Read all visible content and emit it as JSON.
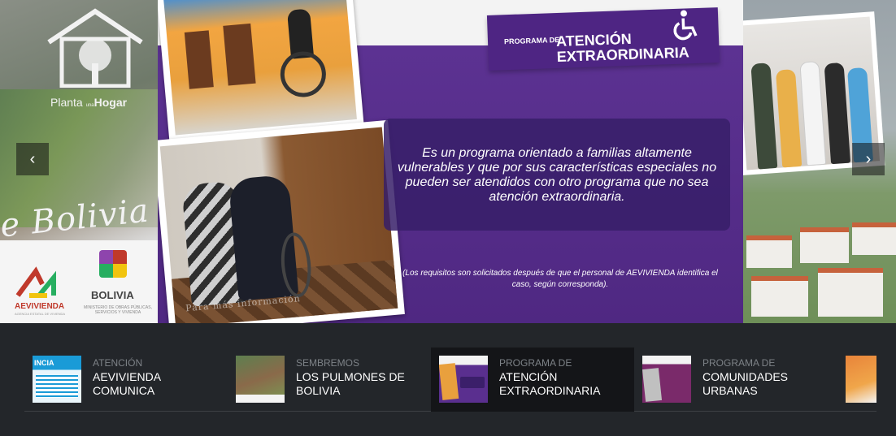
{
  "slider": {
    "left_slide": {
      "brand_plain": "Planta ",
      "brand_small": "una",
      "brand_bold": "Hogar",
      "script_text": "e Bolivia",
      "aevi_name": "AEVIVIENDA",
      "aevi_sub": "AGENCIA ESTATAL DE VIVIENDA",
      "bol_name": "BOLIVIA",
      "bol_sub": "MINISTERIO DE OBRAS PÚBLICAS, SERVICIOS Y VIVIENDA"
    },
    "main_slide": {
      "banner_pre": "PROGRAMA DE",
      "banner_line1": "ATENCIÓN",
      "banner_line2": "EXTRAORDINARIA",
      "photo_caption": "Para más información",
      "description": "Es un programa orientado a familias altamente vulnerables y que por sus características especiales no pueden ser atendidos con otro programa que no sea atención extraordinaria.",
      "note": "(Los requisitos son solicitados después de que el personal de AEVIVIENDA identifica el caso, según corresponda)."
    },
    "prev_arrow": "‹",
    "next_arrow": "›"
  },
  "thumbnails": [
    {
      "sup": "ATENCIÓN",
      "title": "AEVIVIENDA COMUNICA",
      "active": false
    },
    {
      "sup": "SEMBREMOS",
      "title": "LOS PULMONES DE BOLIVIA",
      "active": false
    },
    {
      "sup": "PROGRAMA DE",
      "title": "ATENCIÓN EXTRAORDINARIA",
      "active": true
    },
    {
      "sup": "PROGRAMA DE",
      "title": "COMUNIDADES URBANAS",
      "active": false
    }
  ],
  "thumb1_text": "INCIA"
}
